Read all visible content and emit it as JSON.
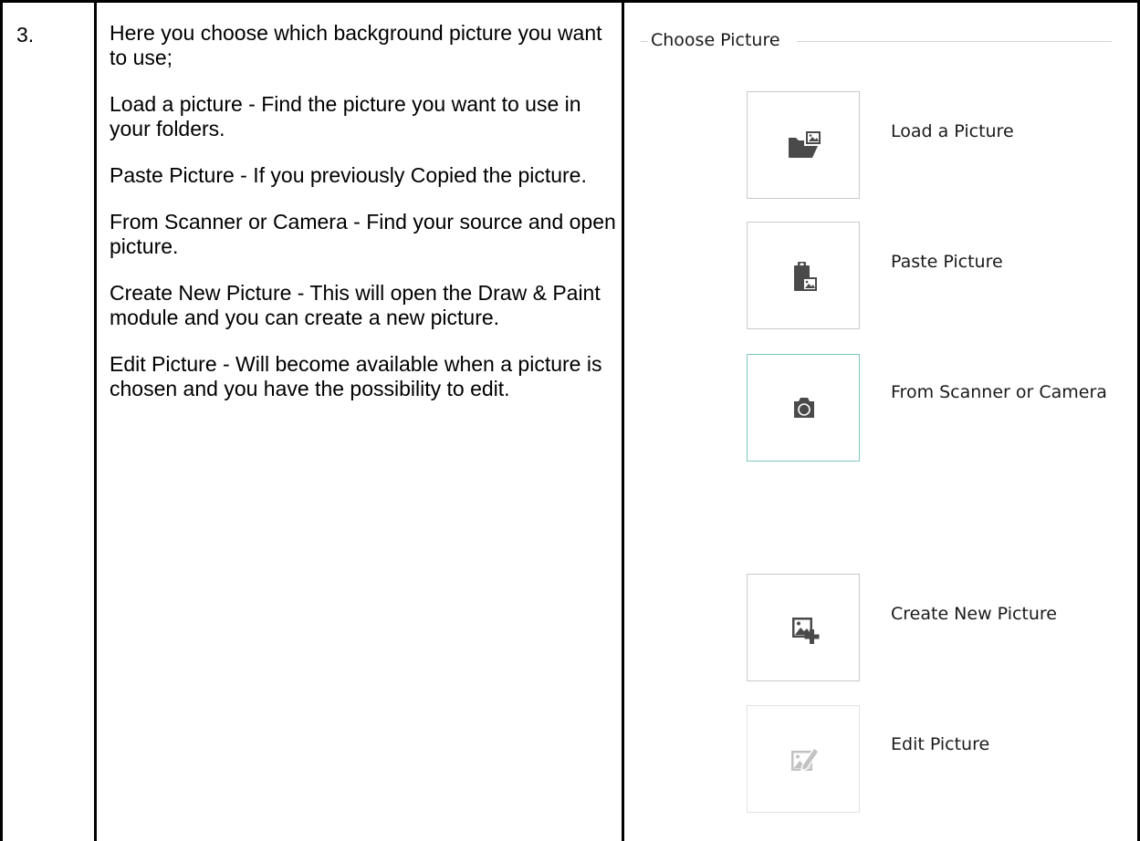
{
  "step": {
    "number": "3."
  },
  "description": {
    "intro": "Here you choose which background picture you want to use;",
    "load": "Load  a picture - Find the picture you want to use in your folders.",
    "paste": "Paste Picture - If you previously Copied the picture.",
    "scanner": "From Scanner or Camera - Find your source and open picture.",
    "create": "Create New Picture - This will open the Draw & Paint module and you can create a new picture.",
    "edit": "Edit Picture - Will become available when a picture is chosen and you have the possibility to edit."
  },
  "panel": {
    "title": "Choose Picture",
    "options": [
      {
        "label": "Load a Picture",
        "icon": "folder-image-icon"
      },
      {
        "label": "Paste Picture",
        "icon": "clipboard-image-icon"
      },
      {
        "label": "From Scanner or Camera",
        "icon": "camera-icon",
        "state": "selected"
      },
      {
        "label": "Create New Picture",
        "icon": "image-add-icon"
      },
      {
        "label": "Edit Picture",
        "icon": "image-edit-icon",
        "state": "disabled"
      }
    ]
  },
  "colors": {
    "icon": "#4a4a4a",
    "icon_disabled": "#c2c2c2",
    "selected_border": "#7fc8bf"
  }
}
